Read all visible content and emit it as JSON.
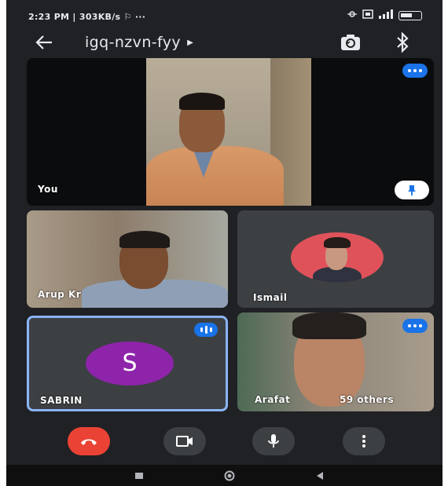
{
  "status_bar": {
    "left_text": "2:23 PM | 303KB/s ⚐ ···",
    "right_icons": [
      "bluetooth-vibrate-icon",
      "sim-icon",
      "signal-icon",
      "battery-icon"
    ]
  },
  "header": {
    "meeting_code": "igq-nzvn-fyy",
    "icons": [
      "back-arrow-icon",
      "caret-right-icon",
      "switch-camera-icon",
      "bluetooth-icon"
    ]
  },
  "participants": {
    "you": {
      "label": "You",
      "icon": "pin-icon"
    },
    "arup": {
      "label": "Arup Kr"
    },
    "ismail": {
      "label": "Ismail"
    },
    "sabrin": {
      "label": "SABRIN",
      "initial": "S",
      "avatar_color": "#8e24aa"
    },
    "arafat": {
      "label": "Arafat",
      "others": "59 others"
    }
  },
  "controls": {
    "icons": [
      "end-call-icon",
      "camera-icon",
      "microphone-icon",
      "more-options-icon"
    ],
    "end_color": "#ea4335"
  },
  "navbar": {
    "icons": [
      "recents-icon",
      "home-icon",
      "back-icon"
    ]
  },
  "colors": {
    "background": "#202124",
    "tile": "#3c4043",
    "accent": "#1a73e8",
    "speaking_border": "#8ab4f8"
  }
}
